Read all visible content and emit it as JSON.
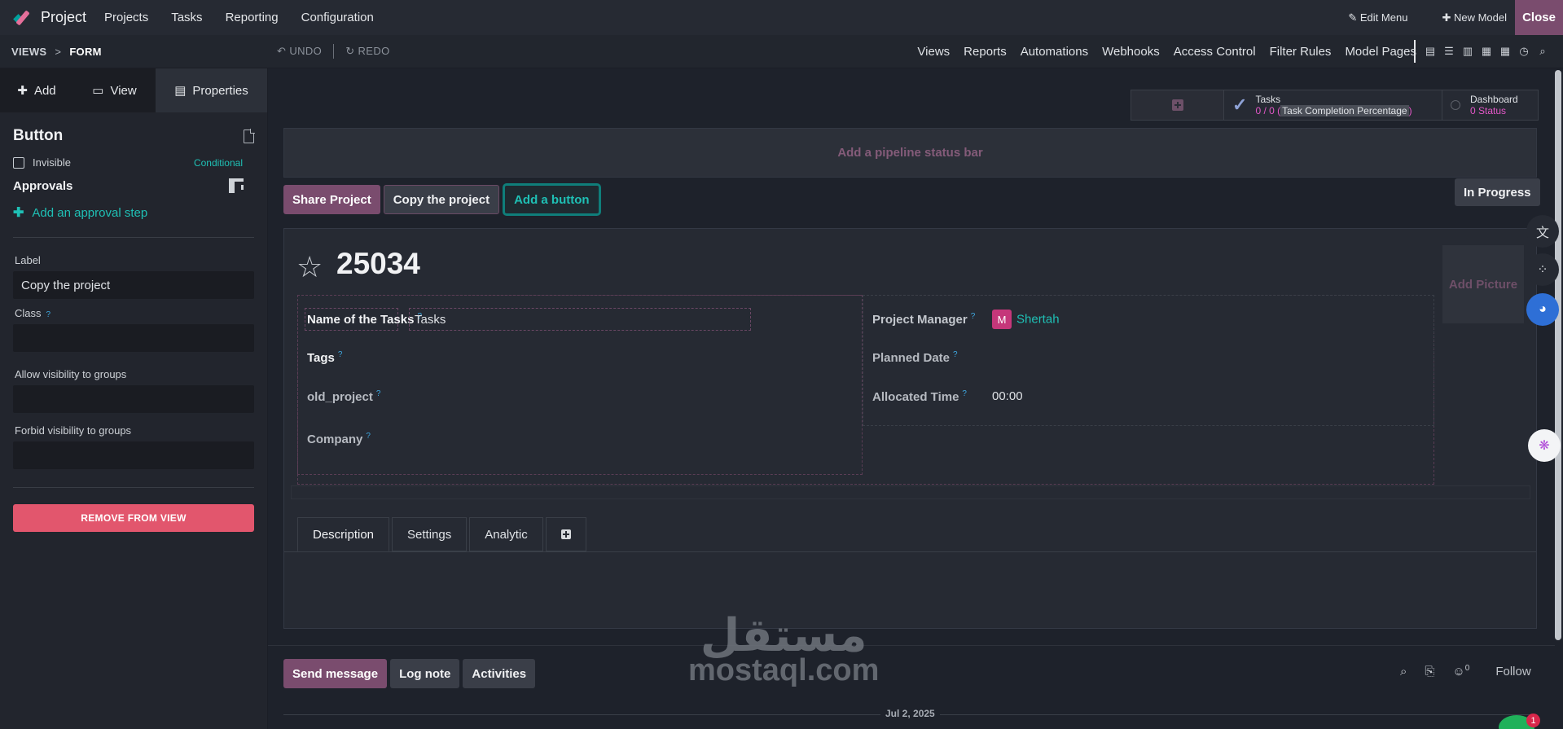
{
  "app": {
    "name": "Project",
    "close_label": "Close"
  },
  "topnav": [
    "Projects",
    "Tasks",
    "Reporting",
    "Configuration"
  ],
  "topright": {
    "edit_menu": "Edit Menu",
    "new_model": "New Model"
  },
  "breadcrumb": {
    "views": "VIEWS",
    "separator": ">",
    "current": "FORM"
  },
  "history": {
    "undo": "UNDO",
    "redo": "REDO"
  },
  "studionav": [
    "Views",
    "Reports",
    "Automations",
    "Webhooks",
    "Access Control",
    "Filter Rules",
    "Model Pages"
  ],
  "view_icons": [
    "form-view-icon",
    "list-view-icon",
    "kanban-view-icon",
    "calendar-view-icon",
    "pivot-view-icon",
    "activity-view-icon",
    "search-view-icon"
  ],
  "sidebar": {
    "tabs": {
      "add": "Add",
      "view": "View",
      "properties": "Properties"
    },
    "title": "Button",
    "invisible_label": "Invisible",
    "conditional": "Conditional",
    "approvals": "Approvals",
    "add_approval": "Add an approval step",
    "label_label": "Label",
    "label_value": "Copy the project",
    "class_label": "Class",
    "allow_label": "Allow visibility to groups",
    "forbid_label": "Forbid visibility to groups",
    "remove": "REMOVE FROM VIEW"
  },
  "smart_buttons": {
    "tasks_title": "Tasks",
    "tasks_count": "0 / 0",
    "tasks_pct": "Task Completion Percentage",
    "dashboard_title": "Dashboard",
    "dashboard_value": "0 Status"
  },
  "pipeline": "Add a pipeline status bar",
  "header_buttons": {
    "share": "Share Project",
    "copy": "Copy the project",
    "add": "Add a button"
  },
  "status": "In Progress",
  "record": {
    "name": "25034",
    "add_picture": "Add Picture",
    "fields": {
      "name_of_tasks": "Name of the Tasks",
      "name_of_tasks_value": "Tasks",
      "tags": "Tags",
      "old_project": "old_project",
      "company": "Company",
      "project_manager": "Project Manager",
      "manager_initial": "M",
      "manager_name": "Shertah",
      "planned_date": "Planned Date",
      "allocated_time": "Allocated Time",
      "allocated_time_value": "00:00"
    },
    "help_mark": "?"
  },
  "tabs": [
    "Description",
    "Settings",
    "Analytic"
  ],
  "chatter": {
    "send": "Send message",
    "log": "Log note",
    "activities": "Activities",
    "followers_count": "0",
    "follow": "Follow",
    "date": "Jul 2, 2025"
  },
  "watermark": {
    "arabic": "مستقل",
    "latin": "mostaql.com"
  },
  "notification_badge": "1",
  "colors": {
    "accent": "#7a4c6e",
    "teal": "#1fc0b5",
    "danger": "#e2566d"
  }
}
